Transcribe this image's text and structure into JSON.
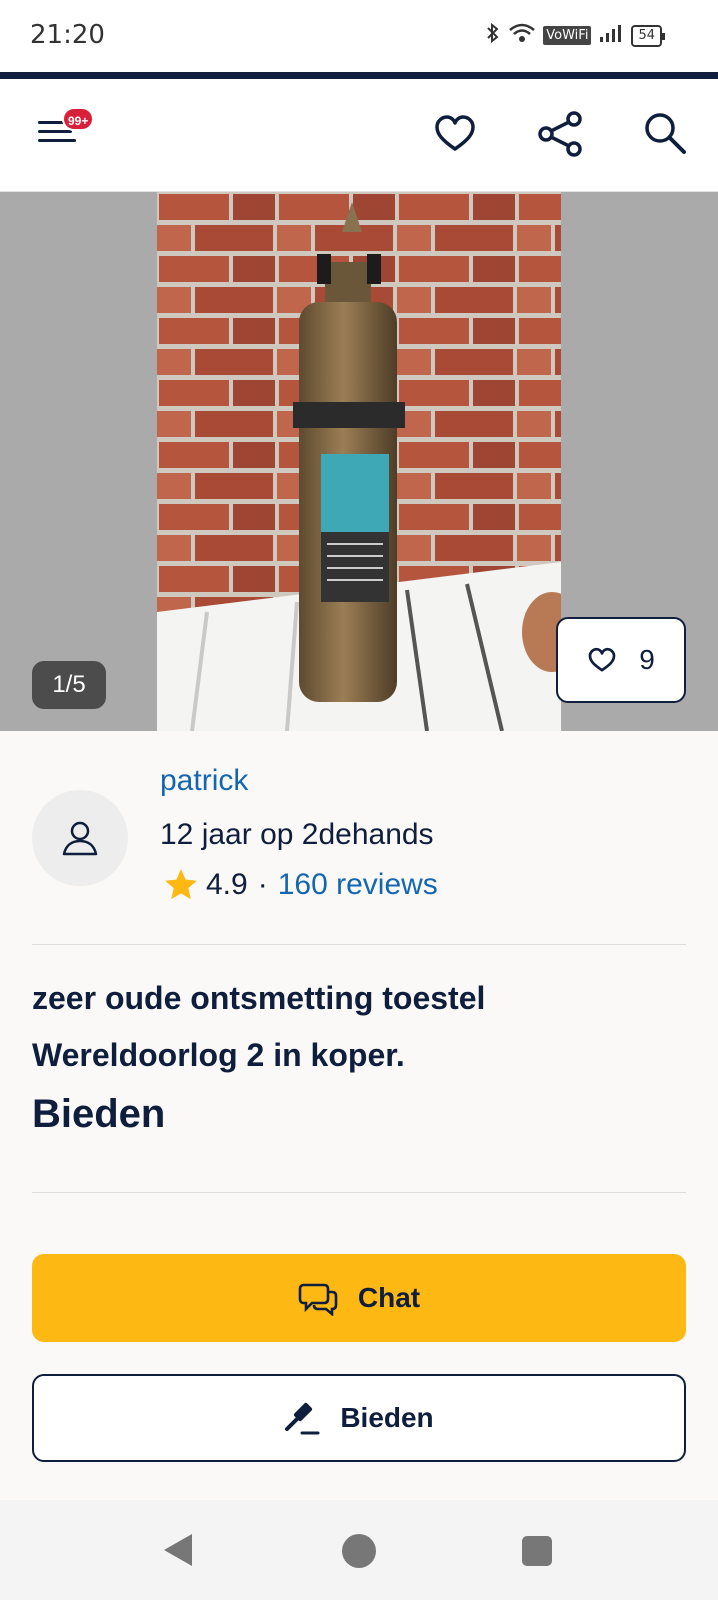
{
  "status_bar": {
    "time": "21:20",
    "vowifi": "VoWiFi",
    "battery": "54"
  },
  "header": {
    "notification_badge": "99+"
  },
  "gallery": {
    "counter": "1/5",
    "favorites_count": "9"
  },
  "seller": {
    "name": "patrick",
    "membership": "12 jaar op 2dehands",
    "rating": "4.9",
    "separator": "·",
    "reviews": "160 reviews"
  },
  "listing": {
    "title": "zeer oude ontsmetting toestel Wereldoorlog 2 in koper.",
    "price": "Bieden"
  },
  "actions": {
    "chat_label": "Chat",
    "bid_label": "Bieden"
  },
  "colors": {
    "brand_navy": "#0e1e3c",
    "accent_yellow": "#fdb813",
    "link_blue": "#1566b0",
    "badge_red": "#d9203a"
  }
}
